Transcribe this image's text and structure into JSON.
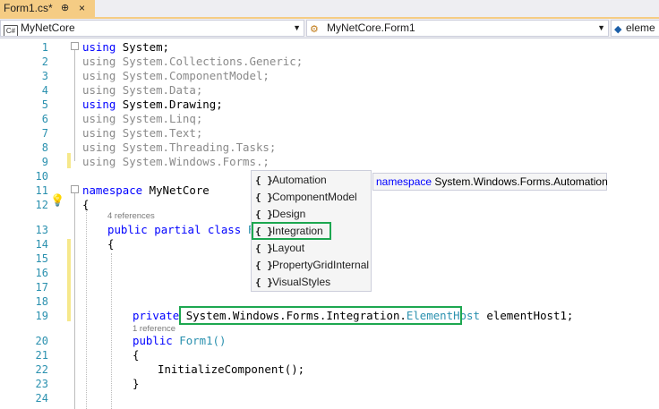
{
  "tab": {
    "title": "Form1.cs*",
    "pin": "⊕",
    "close": "×"
  },
  "nav": {
    "project": "MyNetCore",
    "class": "MyNetCore.Form1",
    "member": "eleme",
    "project_icon": "csharp-project-icon",
    "class_icon": "class-icon",
    "member_icon": "field-icon"
  },
  "lines": [
    {
      "num": "1",
      "text": "using System;",
      "style": "using"
    },
    {
      "num": "2",
      "text": "using System.Collections.Generic;",
      "style": "using-dim"
    },
    {
      "num": "3",
      "text": "using System.ComponentModel;",
      "style": "using-dim"
    },
    {
      "num": "4",
      "text": "using System.Data;",
      "style": "using-dim"
    },
    {
      "num": "5",
      "text": "using System.Drawing;",
      "style": "using"
    },
    {
      "num": "6",
      "text": "using System.Linq;",
      "style": "using-dim"
    },
    {
      "num": "7",
      "text": "using System.Text;",
      "style": "using-dim"
    },
    {
      "num": "8",
      "text": "using System.Threading.Tasks;",
      "style": "using-dim"
    },
    {
      "num": "9",
      "text": "using System.Windows.Forms.;",
      "style": "using-dim"
    },
    {
      "num": "10",
      "text": ""
    },
    {
      "num": "11",
      "text": "namespace MyNetCore"
    },
    {
      "num": "12",
      "text": "{"
    },
    {
      "num": "13",
      "text": "public partial class Fo"
    },
    {
      "num": "14",
      "text": "{"
    },
    {
      "num": "15",
      "text": ""
    },
    {
      "num": "16",
      "text": ""
    },
    {
      "num": "17",
      "text": ""
    },
    {
      "num": "18",
      "text": ""
    },
    {
      "num": "19",
      "text": "private System.Windows.Forms.Integration.ElementHost elementHost1;"
    },
    {
      "num": "20",
      "text": "public Form1()"
    },
    {
      "num": "21",
      "text": "{"
    },
    {
      "num": "22",
      "text": "InitializeComponent();"
    },
    {
      "num": "23",
      "text": "}"
    },
    {
      "num": "24",
      "text": ""
    }
  ],
  "refs": {
    "class_refs": "4 references",
    "ctor_refs": "1 reference"
  },
  "code": {
    "kw_namespace": "namespace",
    "ns_name": "MyNetCore",
    "kw_public": "public",
    "kw_partial": "partial",
    "kw_class": "class",
    "class_partial": "Fo",
    "kw_private": "private",
    "qualified": "System.Windows.Forms.Integration.",
    "type_name": "ElementHost",
    "field": " elementHost1;",
    "ctor": "Form1()",
    "init": "InitializeComponent();",
    "open": "{",
    "close": "}"
  },
  "completion": {
    "items": [
      "Automation",
      "ComponentModel",
      "Design",
      "Integration",
      "Layout",
      "PropertyGridInternal",
      "VisualStyles"
    ],
    "brace": "{ }",
    "tooltip_kw": "namespace",
    "tooltip_text": " System.Windows.Forms.Automation"
  },
  "colors": {
    "keyword": "#0000ff",
    "type": "#2b91af",
    "highlight": "#1da750",
    "tab": "#f5cc84"
  }
}
